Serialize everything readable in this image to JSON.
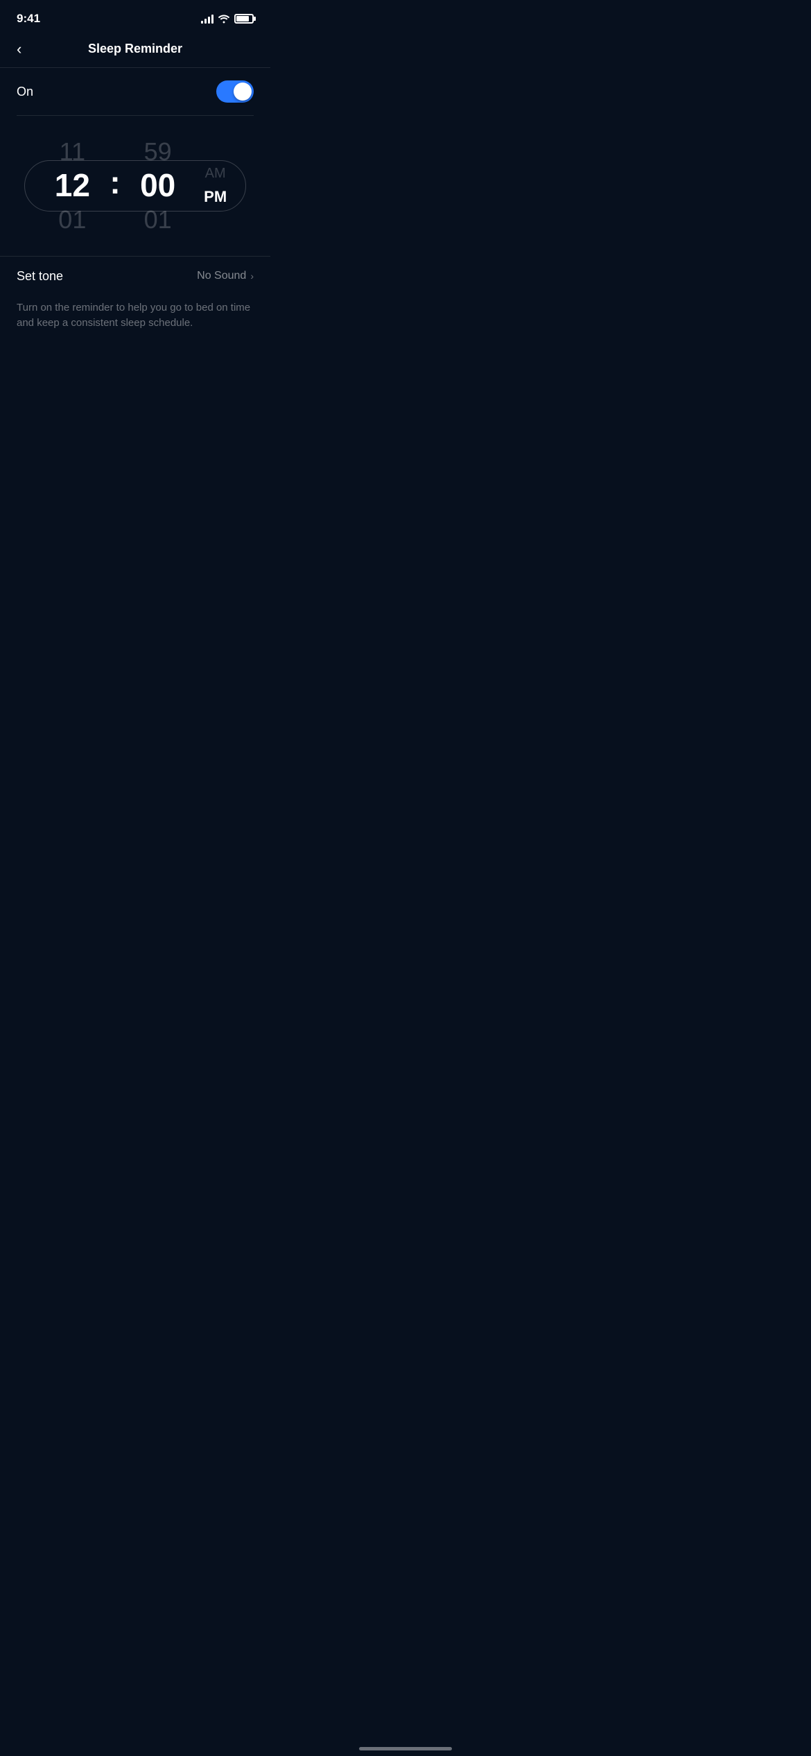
{
  "statusBar": {
    "time": "9:41"
  },
  "header": {
    "back_label": "‹",
    "title": "Sleep Reminder"
  },
  "toggle": {
    "label": "On",
    "is_on": true
  },
  "timePicker": {
    "above_hour": "11",
    "above_minute": "59",
    "above_ampm": "AM",
    "selected_hour": "12",
    "separator": ":",
    "selected_minute": "00",
    "selected_ampm": "PM",
    "below_hour": "01",
    "below_minute": "01"
  },
  "setTone": {
    "label": "Set tone",
    "value": "No Sound",
    "chevron": "›"
  },
  "description": {
    "text": "Turn on the reminder to help you go to bed on time and keep a consistent sleep schedule."
  },
  "colors": {
    "background": "#07101e",
    "toggle_on": "#2979ff",
    "text_primary": "#ffffff",
    "text_dim": "rgba(255,255,255,0.2)",
    "text_muted": "rgba(255,255,255,0.4)",
    "border": "rgba(255,255,255,0.2)"
  }
}
